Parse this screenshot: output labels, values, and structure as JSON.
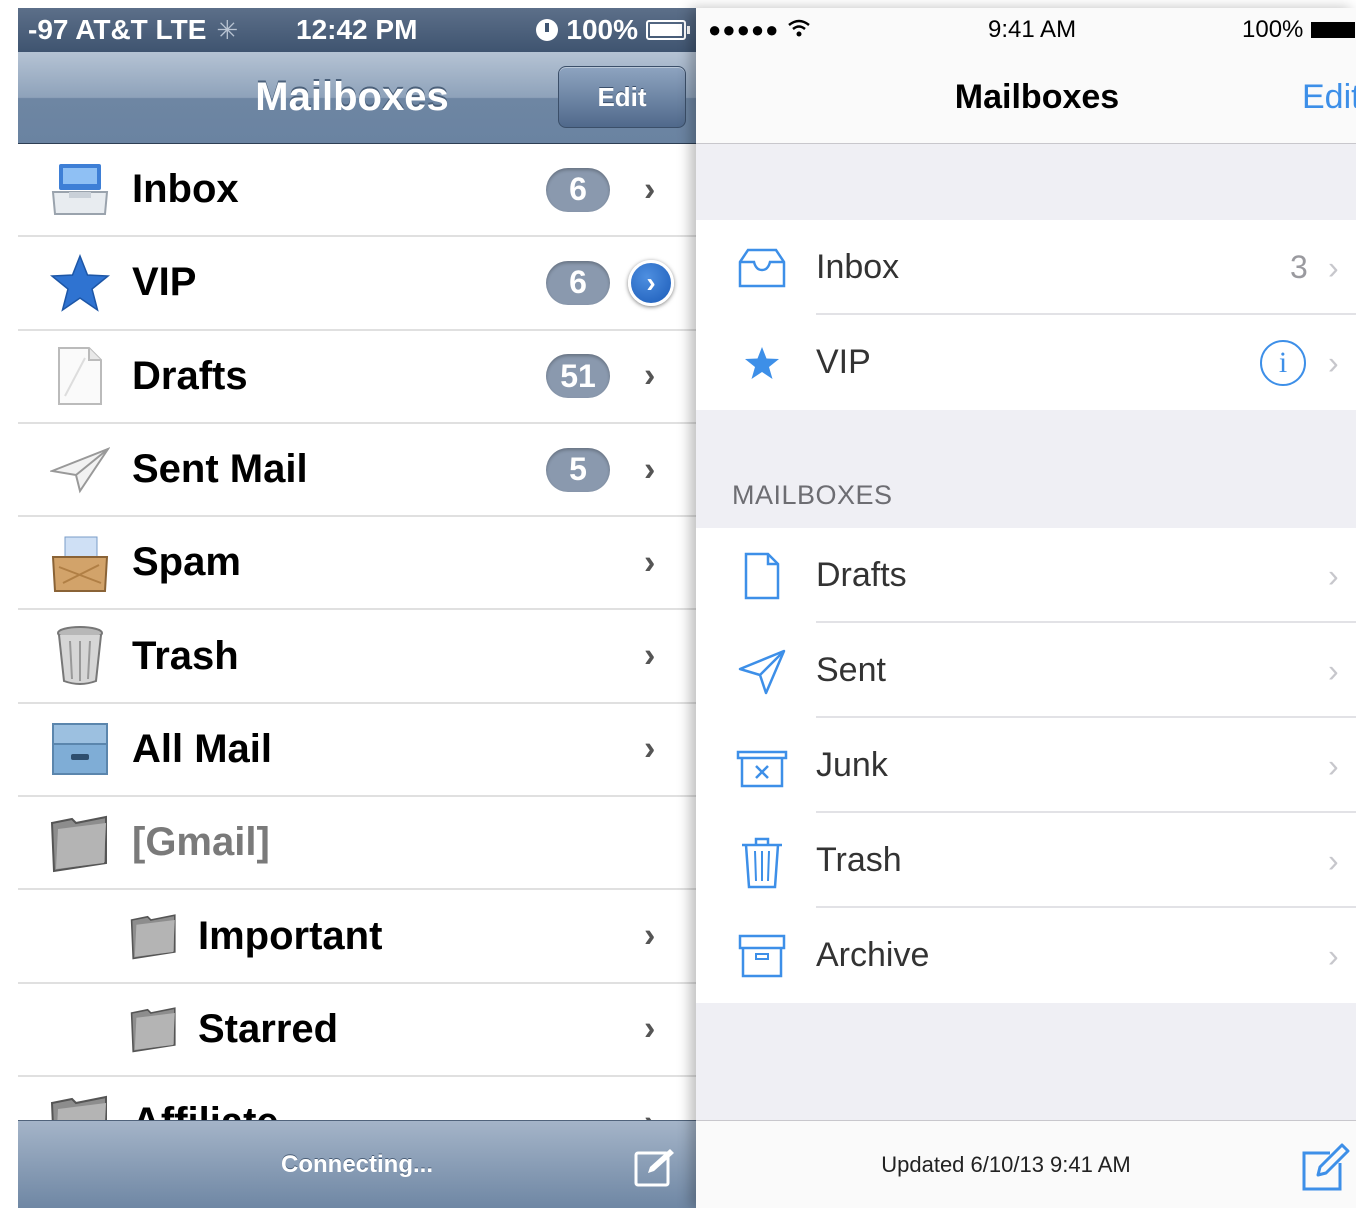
{
  "colors": {
    "ios6_nav": "#7389a6",
    "ios6_badge": "#8a99ae",
    "ios7_accent": "#3d8fe8",
    "ios7_bg": "#efeff4"
  },
  "ios6": {
    "status": {
      "carrier": "-97 AT&T  LTE",
      "time": "12:42 PM",
      "battery": "100%"
    },
    "nav": {
      "title": "Mailboxes",
      "edit_label": "Edit"
    },
    "rows": [
      {
        "label": "Inbox",
        "badge": "6",
        "icon": "inbox-tray-icon"
      },
      {
        "label": "VIP",
        "badge": "6",
        "icon": "star-icon"
      },
      {
        "label": "Drafts",
        "badge": "51",
        "icon": "draft-document-icon"
      },
      {
        "label": "Sent Mail",
        "badge": "5",
        "icon": "paper-plane-icon"
      },
      {
        "label": "Spam",
        "icon": "spam-box-icon"
      },
      {
        "label": "Trash",
        "icon": "trash-can-icon"
      },
      {
        "label": "All Mail",
        "icon": "archive-box-icon"
      },
      {
        "label": "[Gmail]",
        "icon": "folder-icon"
      },
      {
        "label": "Important",
        "icon": "folder-icon"
      },
      {
        "label": "Starred",
        "icon": "folder-icon"
      },
      {
        "label": "Affiliate",
        "icon": "folder-icon"
      }
    ],
    "toolbar": {
      "status": "Connecting..."
    }
  },
  "ios7": {
    "status": {
      "time": "9:41 AM",
      "battery": "100%"
    },
    "nav": {
      "title": "Mailboxes",
      "edit_label": "Edit"
    },
    "top_rows": [
      {
        "label": "Inbox",
        "count": "3",
        "icon": "inbox-tray-icon"
      },
      {
        "label": "VIP",
        "icon": "star-icon"
      }
    ],
    "section_header": "MAILBOXES",
    "mailbox_rows": [
      {
        "label": "Drafts",
        "icon": "document-icon"
      },
      {
        "label": "Sent",
        "icon": "paper-plane-icon"
      },
      {
        "label": "Junk",
        "icon": "junk-box-icon"
      },
      {
        "label": "Trash",
        "icon": "trash-can-icon"
      },
      {
        "label": "Archive",
        "icon": "archive-box-icon"
      }
    ],
    "toolbar": {
      "status": "Updated 6/10/13 9:41 AM"
    }
  }
}
